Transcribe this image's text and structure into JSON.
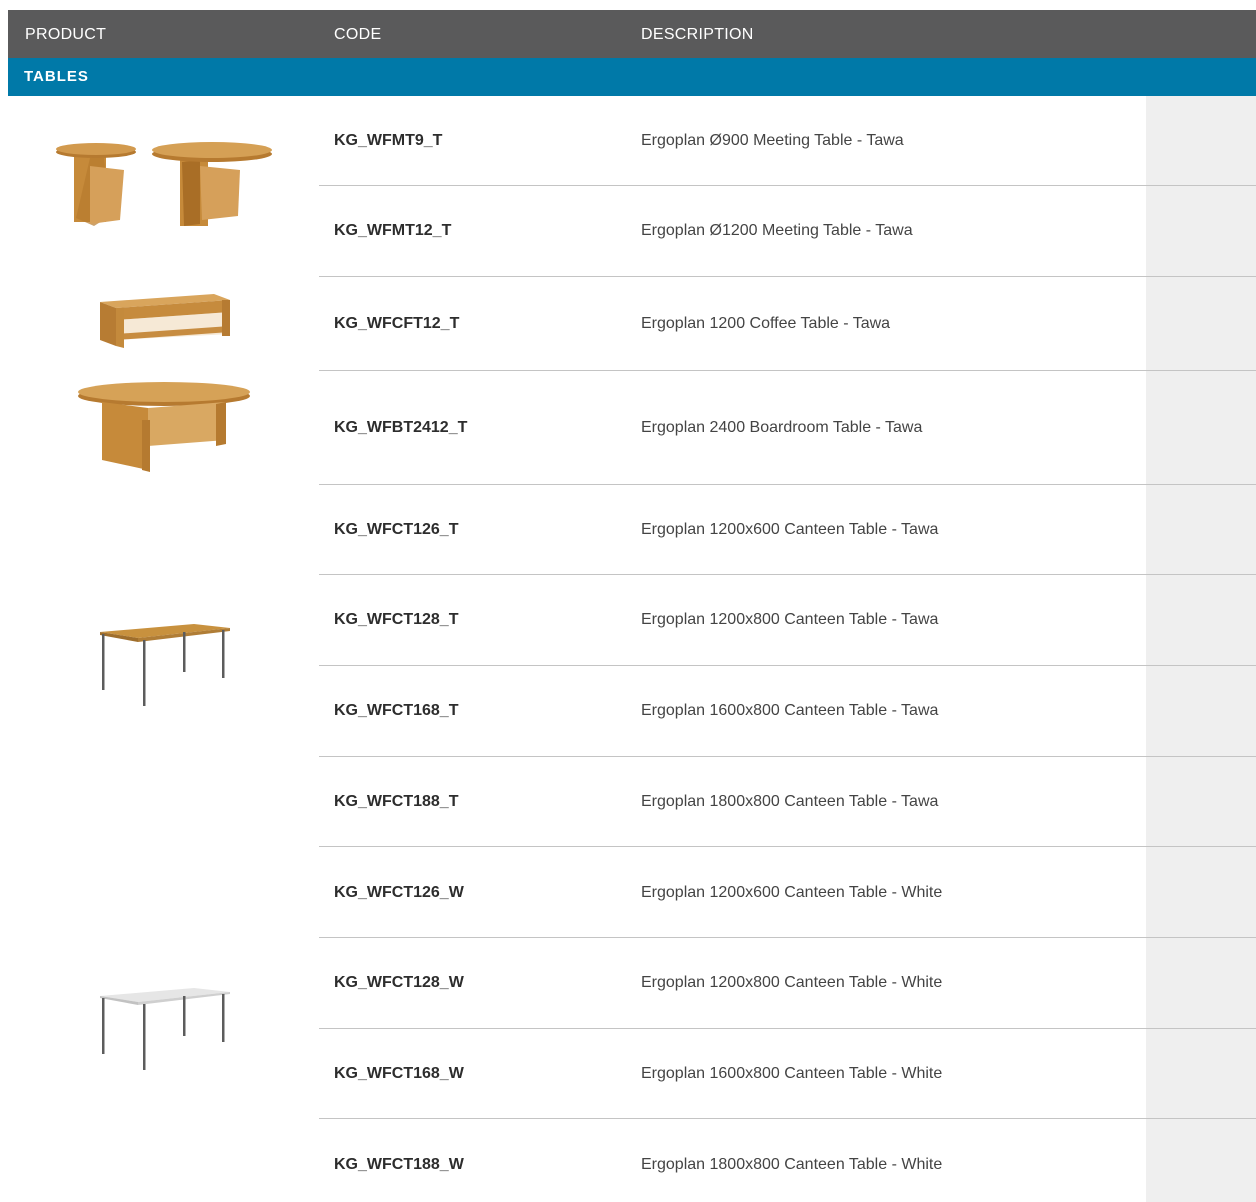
{
  "header": {
    "product": "PRODUCT",
    "code": "CODE",
    "description": "DESCRIPTION"
  },
  "section": {
    "title": "TABLES"
  },
  "rows": [
    {
      "code": "KG_WFMT9_T",
      "description": "Ergoplan Ø900 Meeting Table - Tawa"
    },
    {
      "code": "KG_WFMT12_T",
      "description": "Ergoplan Ø1200 Meeting Table - Tawa"
    },
    {
      "code": "KG_WFCFT12_T",
      "description": "Ergoplan 1200 Coffee Table - Tawa"
    },
    {
      "code": "KG_WFBT2412_T",
      "description": "Ergoplan 2400 Boardroom Table - Tawa"
    },
    {
      "code": "KG_WFCT126_T",
      "description": "Ergoplan 1200x600 Canteen Table - Tawa"
    },
    {
      "code": "KG_WFCT128_T",
      "description": "Ergoplan 1200x800 Canteen Table - Tawa"
    },
    {
      "code": "KG_WFCT168_T",
      "description": "Ergoplan 1600x800 Canteen Table - Tawa"
    },
    {
      "code": "KG_WFCT188_T",
      "description": "Ergoplan 1800x800 Canteen Table - Tawa"
    },
    {
      "code": "KG_WFCT126_W",
      "description": "Ergoplan 1200x600 Canteen Table - White"
    },
    {
      "code": "KG_WFCT128_W",
      "description": "Ergoplan 1200x800 Canteen Table - White"
    },
    {
      "code": "KG_WFCT168_W",
      "description": "Ergoplan 1600x800 Canteen Table - White"
    },
    {
      "code": "KG_WFCT188_W",
      "description": "Ergoplan 1800x800 Canteen Table - White"
    }
  ],
  "colors": {
    "header_bg": "#5a5a5b",
    "section_bg": "#0079a8",
    "tawa": "#c8913e",
    "white_top": "#e6e6e6",
    "leg": "#5c5c5c"
  },
  "images": [
    "round-meeting-tables-tawa",
    "coffee-table-tawa",
    "boardroom-table-tawa",
    "canteen-table-tawa",
    "canteen-table-white"
  ]
}
